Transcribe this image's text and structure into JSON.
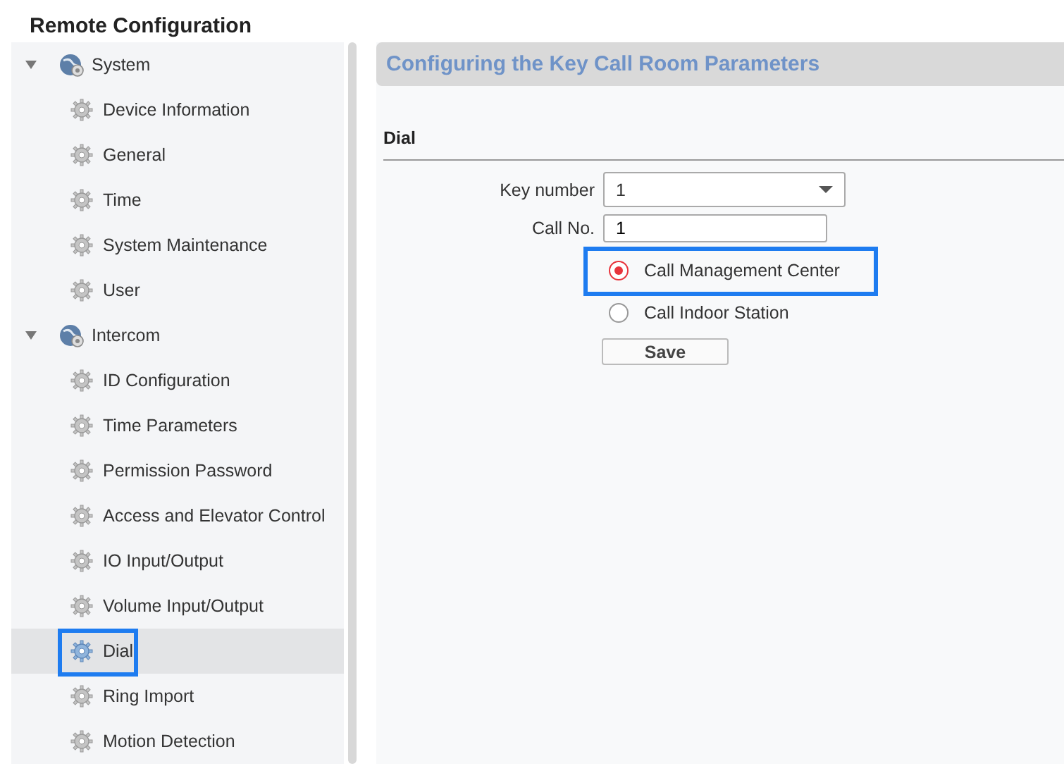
{
  "window": {
    "title": "Remote Configuration"
  },
  "sidebar": {
    "items": [
      {
        "label": "System",
        "expanded": true,
        "children": [
          {
            "label": "Device Information",
            "selected": false,
            "highlighted": false
          },
          {
            "label": "General",
            "selected": false,
            "highlighted": false
          },
          {
            "label": "Time",
            "selected": false,
            "highlighted": false
          },
          {
            "label": "System Maintenance",
            "selected": false,
            "highlighted": false
          },
          {
            "label": "User",
            "selected": false,
            "highlighted": false
          }
        ]
      },
      {
        "label": "Intercom",
        "expanded": true,
        "children": [
          {
            "label": "ID Configuration",
            "selected": false,
            "highlighted": false
          },
          {
            "label": "Time Parameters",
            "selected": false,
            "highlighted": false
          },
          {
            "label": "Permission Password",
            "selected": false,
            "highlighted": false
          },
          {
            "label": "Access and Elevator Control",
            "selected": false,
            "highlighted": false
          },
          {
            "label": "IO Input/Output",
            "selected": false,
            "highlighted": false
          },
          {
            "label": "Volume Input/Output",
            "selected": false,
            "highlighted": false
          },
          {
            "label": "Dial",
            "selected": true,
            "highlighted": true
          },
          {
            "label": "Ring Import",
            "selected": false,
            "highlighted": false
          },
          {
            "label": "Motion Detection",
            "selected": false,
            "highlighted": false
          }
        ]
      }
    ]
  },
  "panel": {
    "title": "Configuring the Key Call Room Parameters",
    "section": "Dial",
    "fields": [
      {
        "kind": "select",
        "label": "Key number",
        "value": "1"
      },
      {
        "kind": "text",
        "label": "Call No.",
        "value": "1"
      }
    ],
    "options": [
      {
        "label": "Call Management Center",
        "selected": true,
        "highlighted": true
      },
      {
        "label": "Call Indoor Station",
        "selected": false,
        "highlighted": false
      }
    ],
    "button": "Save"
  }
}
